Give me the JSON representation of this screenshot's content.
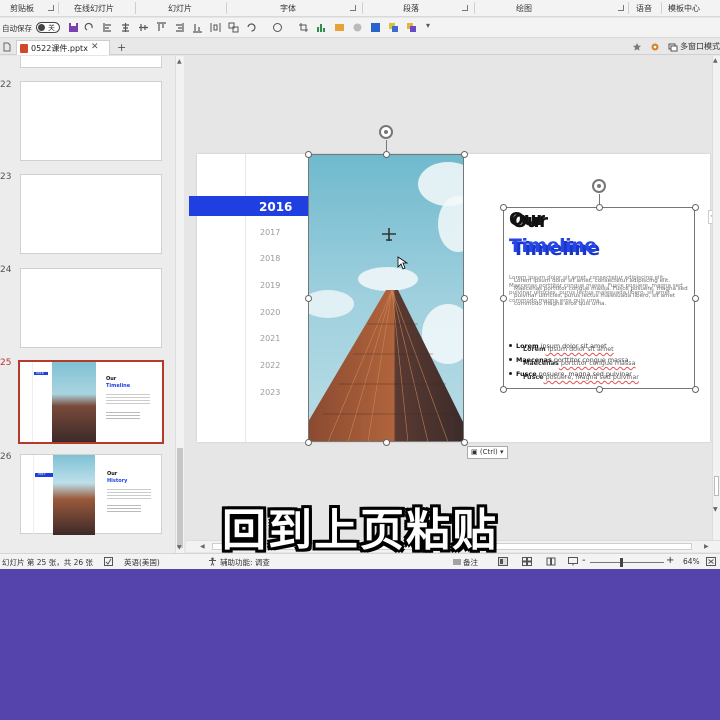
{
  "ribbon": {
    "groups": [
      "剪贴板",
      "在线幻灯片",
      "幻灯片",
      "字体",
      "段落",
      "绘图",
      "语音",
      "模板中心"
    ]
  },
  "qat": {
    "autosave_label": "自动保存",
    "autosave_state": "关"
  },
  "tabs": {
    "doc_name": "0522课件.pptx",
    "close": "✕",
    "new": "+",
    "multi_window": "多窗口模式"
  },
  "thumbnails": [
    {
      "num": "22"
    },
    {
      "num": "23"
    },
    {
      "num": "24"
    },
    {
      "num": "25",
      "title1": "Our",
      "title2": "Timeline",
      "year": "2016"
    },
    {
      "num": "26",
      "title1": "Our",
      "title2": "History",
      "year": "2017"
    }
  ],
  "slide": {
    "active_year": "2016",
    "years": [
      "2017",
      "2018",
      "2019",
      "2020",
      "2021",
      "2022",
      "2023"
    ],
    "title_line1": "Our",
    "title_line2": "Timeline",
    "para1": "Lorem ipsum dolor sit amet, consectetur adipiscing elit. Maecenas porttitor congue massa. Fusce posuere, magna sed pulvinar ultricies, purus lectus malesuada libero, sit amet commodo magna eros quis urna.",
    "bullets": [
      {
        "bold": "Lorem",
        "rest": " ipsum dolor sit amet"
      },
      {
        "bold": "Maecenas",
        "rest": " porttitor congue massa"
      },
      {
        "bold": "Fusce",
        "rest": " posuere, magna sed pulvinar"
      }
    ],
    "paste_label": "(Ctrl)"
  },
  "status": {
    "slide_info": "幻灯片 第 25 张，共 26 张",
    "language": "英语(美国)",
    "accessibility": "辅助功能: 调查",
    "notes": "备注",
    "zoom": "64%"
  },
  "caption": "回到上页粘贴",
  "colors": {
    "accent_blue": "#1f3fe0",
    "selected_thumb": "#b53a2c",
    "background_purple": "#5644ad"
  }
}
